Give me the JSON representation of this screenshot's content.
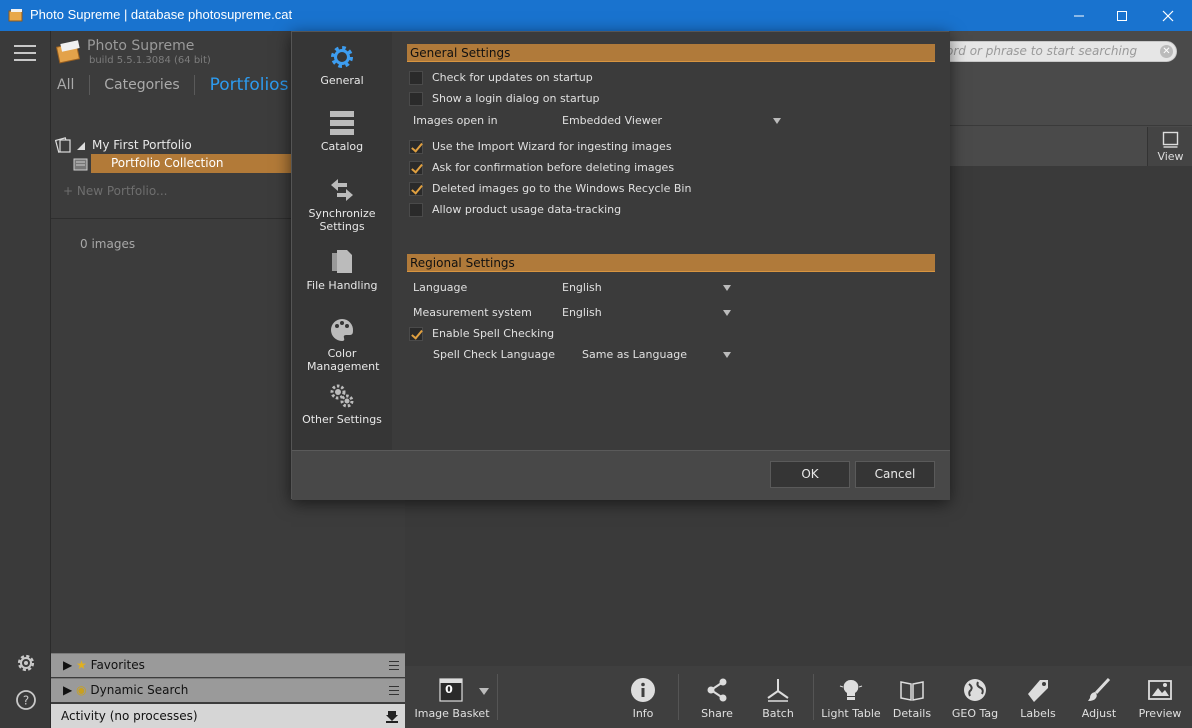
{
  "window": {
    "title": "Photo Supreme | database photosupreme.cat"
  },
  "leftpanel": {
    "app_name": "Photo Supreme",
    "build": "build 5.5.1.3084 (64 bit)",
    "tabs": [
      {
        "label": "All"
      },
      {
        "label": "Categories"
      },
      {
        "label": "Portfolios"
      }
    ],
    "tree": {
      "portfolio": "My First Portfolio",
      "collection": "Portfolio Collection",
      "new_portfolio": "+ New Portfolio..."
    },
    "images_count": "0 images",
    "accordions": [
      {
        "label": "Favorites"
      },
      {
        "label": "Dynamic Search"
      }
    ],
    "activity": "Activity (no processes)"
  },
  "main": {
    "search_placeholder": "ord or phrase to start searching",
    "view_label": "View",
    "bottom_bar": [
      {
        "label": "Image Basket",
        "badge": "0"
      },
      {
        "label": "Info"
      },
      {
        "label": "Share"
      },
      {
        "label": "Batch"
      },
      {
        "label": "Light Table"
      },
      {
        "label": "Details"
      },
      {
        "label": "GEO Tag"
      },
      {
        "label": "Labels"
      },
      {
        "label": "Adjust"
      },
      {
        "label": "Preview"
      }
    ]
  },
  "dialog": {
    "sidebar": [
      {
        "label": "General",
        "icon": "gear-icon"
      },
      {
        "label": "Catalog",
        "icon": "database-icon"
      },
      {
        "label": "Synchronize Settings",
        "icon": "sync-icon"
      },
      {
        "label": "File Handling",
        "icon": "files-icon"
      },
      {
        "label": "Color Management",
        "icon": "palette-icon"
      },
      {
        "label": "Other Settings",
        "icon": "gears-icon"
      }
    ],
    "general_section": "General Settings",
    "general": {
      "check_updates": {
        "label": "Check for updates on startup",
        "checked": false
      },
      "login_dialog": {
        "label": "Show a login dialog on startup",
        "checked": false
      },
      "images_open_in": {
        "label": "Images open in",
        "value": "Embedded Viewer"
      },
      "import_wizard": {
        "label": "Use the Import Wizard for ingesting images",
        "checked": true
      },
      "confirm_delete": {
        "label": "Ask for confirmation before deleting images",
        "checked": true
      },
      "recycle_bin": {
        "label": "Deleted images go to the Windows Recycle Bin",
        "checked": true
      },
      "data_tracking": {
        "label": "Allow product usage data-tracking",
        "checked": false
      }
    },
    "regional_section": "Regional Settings",
    "regional": {
      "language": {
        "label": "Language",
        "value": "English"
      },
      "measurement": {
        "label": "Measurement system",
        "value": "English"
      },
      "spell_check": {
        "label": "Enable Spell Checking",
        "checked": true
      },
      "spell_language": {
        "label": "Spell Check Language",
        "value": "Same as Language"
      }
    },
    "ok_label": "OK",
    "cancel_label": "Cancel"
  },
  "colors": {
    "titlebar": "#1973cf",
    "accent_orange": "#b07a3a",
    "active_tab": "#2d9bef"
  }
}
